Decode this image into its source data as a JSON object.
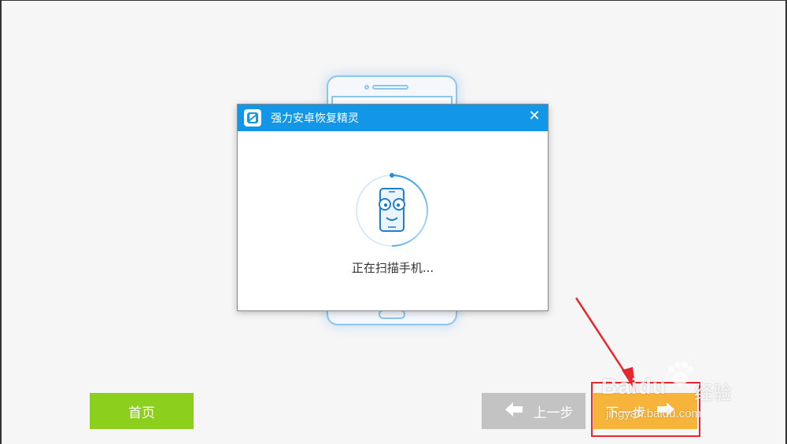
{
  "dialog": {
    "title": "强力安卓恢复精灵",
    "close_icon": "close-icon",
    "status_text": "正在扫描手机..."
  },
  "buttons": {
    "home_label": "首页",
    "prev_label": "上一步",
    "next_label": "下一步"
  },
  "watermark": {
    "brand": "Baidu",
    "cn": "经验",
    "url": "jingyan.baidu.com"
  },
  "colors": {
    "titlebar": "#1296e8",
    "home_button": "#8ccf1c",
    "prev_button": "#c3c3c3",
    "next_button": "#f7b43a",
    "annotation": "#e8262d"
  }
}
